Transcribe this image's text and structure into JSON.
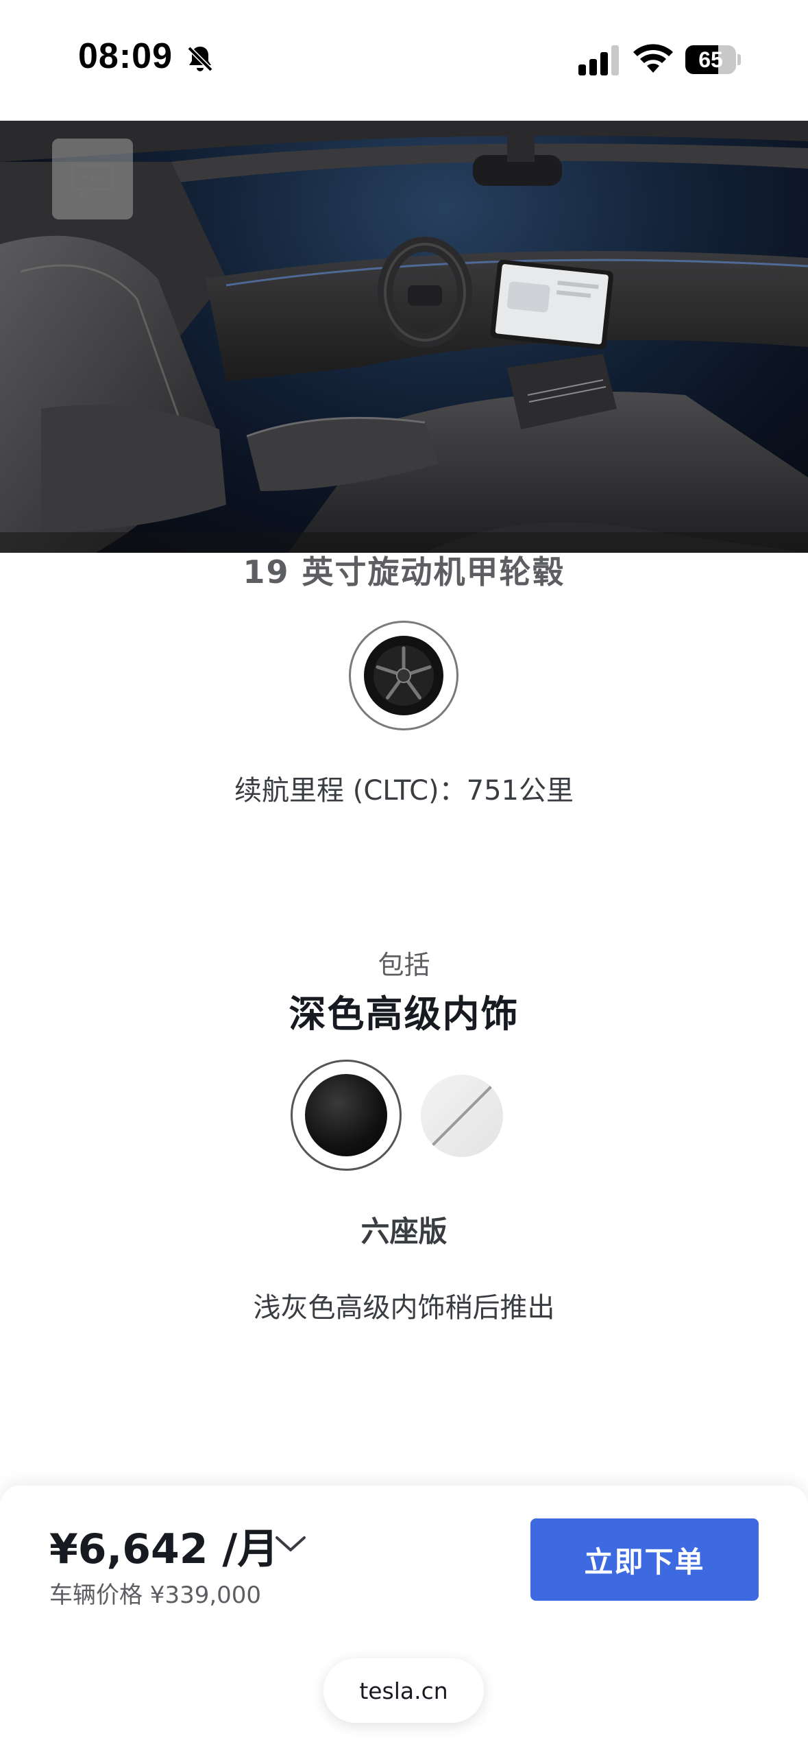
{
  "status_bar": {
    "time": "08:09",
    "battery_level": "65",
    "battery_fraction": 0.65,
    "icons": [
      "bell-slash-icon",
      "signal-icon",
      "wifi-icon",
      "battery-icon"
    ]
  },
  "hero": {
    "image_subject": "car-interior-photo",
    "chat_icon": "chat-bubble-icon"
  },
  "wheels": {
    "title": "19 英寸旋动机甲轮毂",
    "range_text": "续航里程 (CLTC)：751公里"
  },
  "interior": {
    "include_label": "包括",
    "title": "深色高级内饰",
    "swatches": [
      {
        "name": "dark",
        "color": "#111111",
        "selected": true
      },
      {
        "name": "light",
        "color": "#e8e8e8",
        "selected": false,
        "unavailable": true
      }
    ],
    "seat_label": "六座版",
    "note": "浅灰色高级内饰稍后推出"
  },
  "footer": {
    "monthly_price": "¥6,642 /月",
    "vehicle_price": "车辆价格 ¥339,000",
    "order_button": "立即下单",
    "url": "tesla.cn",
    "accent_color": "#3e6ae1"
  }
}
